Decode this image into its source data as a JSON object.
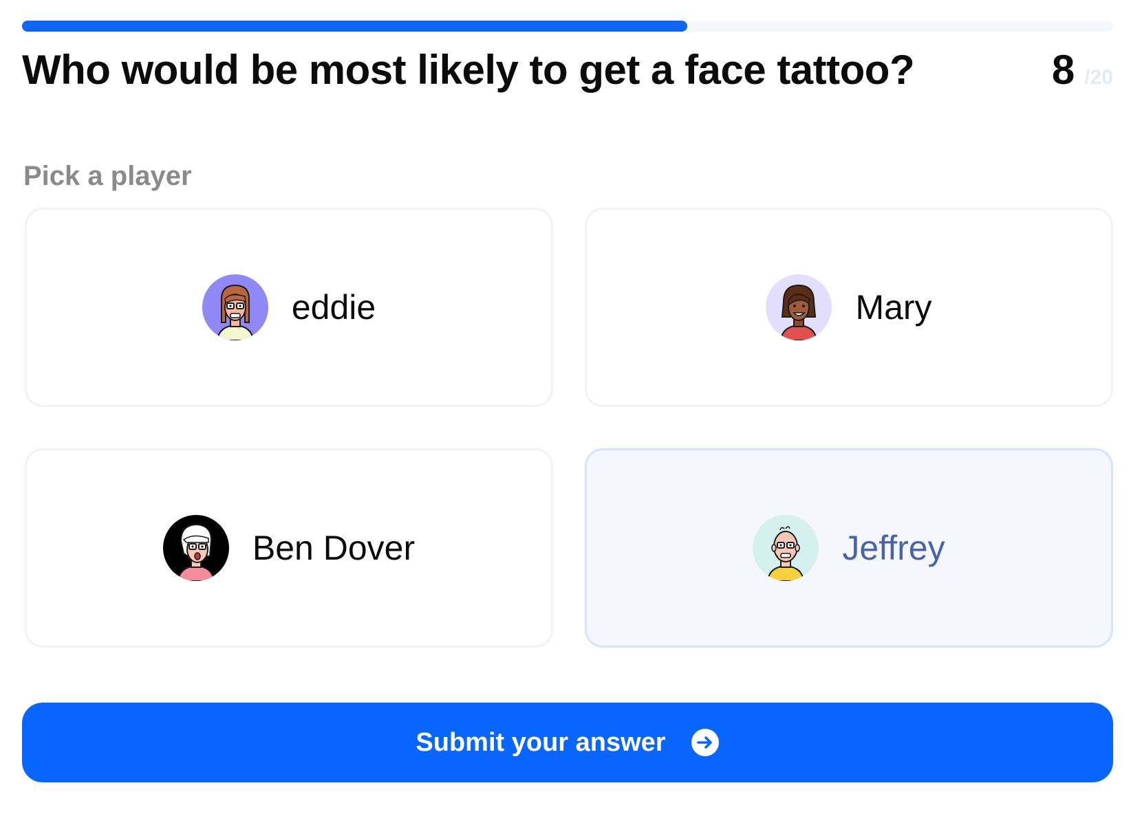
{
  "progress": {
    "current": 8,
    "total": 20,
    "fraction": 0.61
  },
  "question": {
    "text": "Who would be most likely to get a face tattoo?"
  },
  "counter": {
    "current": "8",
    "total": "/20"
  },
  "picker": {
    "label": "Pick a player",
    "players": [
      {
        "name": "eddie",
        "avatar": "avatar-eddie",
        "selected": false,
        "avatar_bg": "#9088f5"
      },
      {
        "name": "Mary",
        "avatar": "avatar-mary",
        "selected": false,
        "avatar_bg": "#e3defb"
      },
      {
        "name": "Ben Dover",
        "avatar": "avatar-ben-dover",
        "selected": false,
        "avatar_bg": "#000000"
      },
      {
        "name": "Jeffrey",
        "avatar": "avatar-jeffrey",
        "selected": true,
        "avatar_bg": "#d4f0ef"
      }
    ]
  },
  "submit": {
    "label": "Submit your answer",
    "icon": "arrow-right-circle-icon"
  },
  "colors": {
    "accent": "#0866ff",
    "progress_track": "#f4f7fc",
    "selected_card_bg": "#f4f8fe",
    "selected_text": "#4a63a8"
  }
}
